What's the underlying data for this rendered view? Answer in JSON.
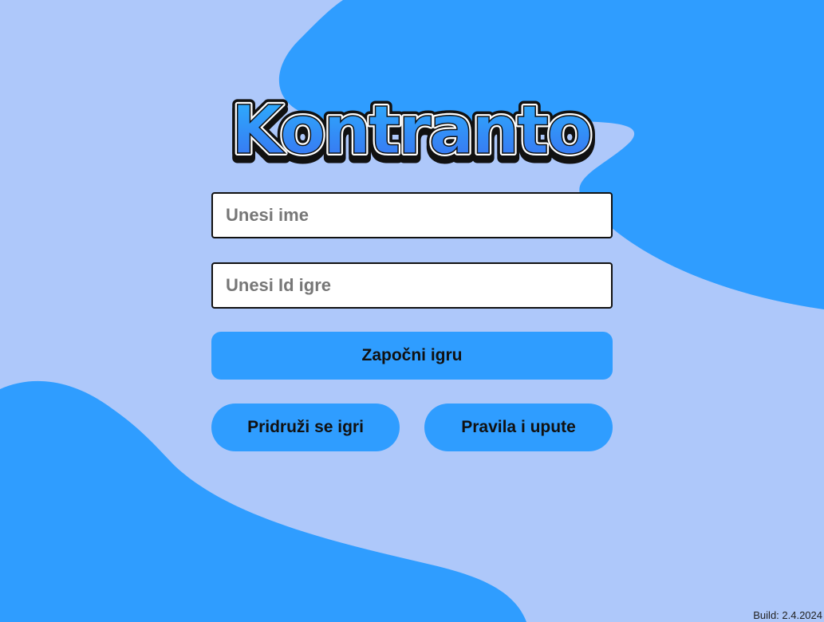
{
  "app": {
    "title": "Kontranto"
  },
  "form": {
    "name_placeholder": "Unesi ime",
    "game_id_placeholder": "Unesi Id igre",
    "start_button": "Započni igru",
    "join_button": "Pridruži se igri",
    "rules_button": "Pravila i upute"
  },
  "footer": {
    "build": "Build: 2.4.2024"
  },
  "colors": {
    "background": "#aec8fa",
    "accent": "#2f9dff",
    "logo_gradient_top": "#2bb4ff",
    "logo_gradient_bottom": "#3a6ef0",
    "logo_shadow": "#f3f07a"
  }
}
